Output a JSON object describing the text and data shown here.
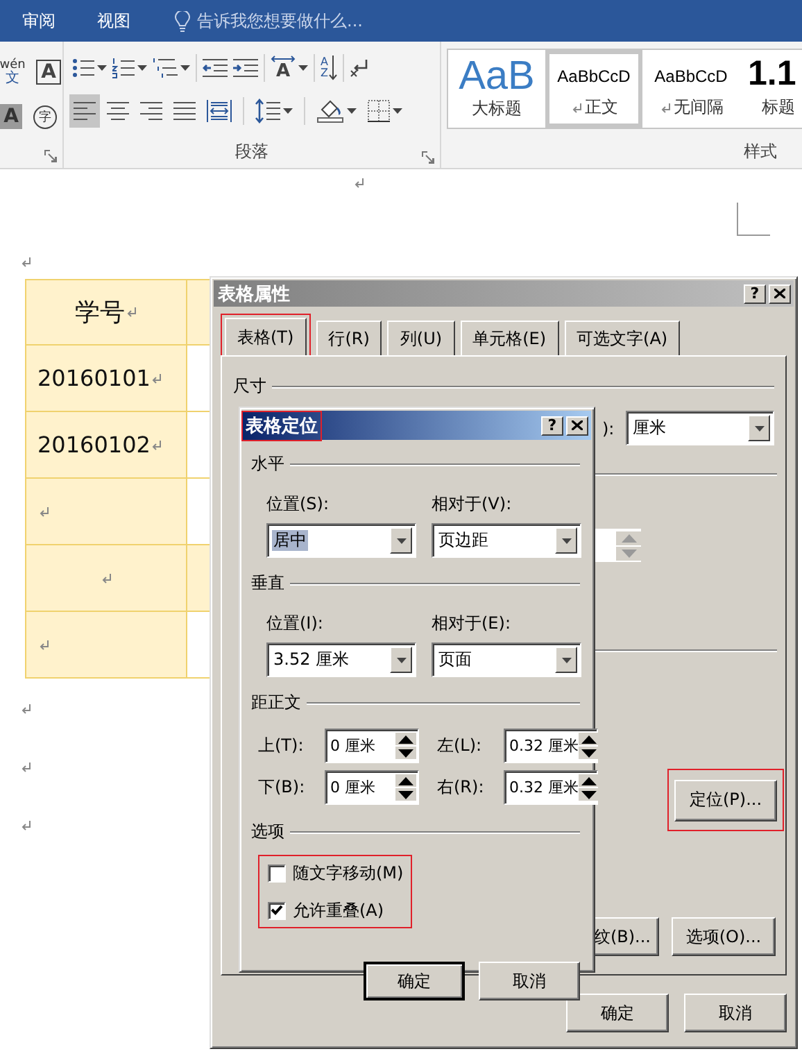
{
  "top_bar": {
    "tabs": [
      {
        "label": "审阅",
        "selected": false
      },
      {
        "label": "视图",
        "selected": false
      }
    ],
    "search": {
      "placeholder": "告诉我您想要做什么..."
    }
  },
  "ribbon": {
    "font_tools": [
      {
        "kind": "phonetic",
        "glyph": "wén",
        "sub": "文"
      },
      {
        "kind": "boxed",
        "glyph": "A"
      },
      {
        "kind": "shaded",
        "glyph": "A"
      },
      {
        "kind": "circled",
        "glyph": "字"
      }
    ],
    "paragraph": {
      "label": "段落",
      "rows": [
        [
          {
            "kind": "bullets",
            "dropdown": true,
            "selected": false
          },
          {
            "kind": "numbering",
            "dropdown": true,
            "selected": false
          },
          {
            "kind": "multilevel",
            "dropdown": true,
            "selected": false
          },
          {
            "kind": "outdent",
            "dropdown": false,
            "selected": false
          },
          {
            "kind": "indent",
            "dropdown": false,
            "selected": false
          },
          {
            "kind": "asian-layout",
            "glyph": "A",
            "dropdown": true,
            "selected": false
          },
          {
            "kind": "sort",
            "glyph": "A",
            "glyph2": "Z",
            "dropdown": false,
            "selected": false
          },
          {
            "kind": "marks",
            "dropdown": false,
            "selected": false
          }
        ],
        [
          {
            "kind": "align-left",
            "dropdown": false,
            "selected": true
          },
          {
            "kind": "align-center",
            "dropdown": false,
            "selected": false
          },
          {
            "kind": "align-right",
            "dropdown": false,
            "selected": false
          },
          {
            "kind": "justify",
            "dropdown": false,
            "selected": false
          },
          {
            "kind": "distribute",
            "dropdown": false,
            "selected": false
          },
          {
            "kind": "line-spacing",
            "dropdown": true,
            "selected": false
          },
          {
            "kind": "shading",
            "dropdown": true,
            "selected": false
          },
          {
            "kind": "borders",
            "dropdown": true,
            "selected": false
          }
        ]
      ]
    },
    "styles": {
      "label": "样式",
      "items": [
        {
          "kind": "title",
          "preview": "AaB",
          "name": "大标题",
          "para_mark": false,
          "selected": false
        },
        {
          "kind": "normal",
          "preview": "AaBbCcD",
          "name": "正文",
          "para_mark": true,
          "selected": true
        },
        {
          "kind": "normal",
          "preview": "AaBbCcD",
          "name": "无间隔",
          "para_mark": true,
          "selected": false
        },
        {
          "kind": "heading",
          "preview": "1.1",
          "name": "标题",
          "para_mark": false,
          "selected": false
        }
      ]
    }
  },
  "document": {
    "table": {
      "rows": [
        {
          "kind": "header",
          "text": "学号",
          "centered": true,
          "column_2_shaded": true
        },
        {
          "kind": "data",
          "text": "20160101",
          "centered": false,
          "column_2_shaded": false
        },
        {
          "kind": "data",
          "text": "20160102",
          "centered": false,
          "column_2_shaded": false
        },
        {
          "kind": "data",
          "centered": false,
          "column_2_shaded": false
        },
        {
          "kind": "data",
          "centered": true,
          "column_2_shaded": true
        },
        {
          "kind": "data",
          "centered": false,
          "column_2_shaded": false
        }
      ]
    }
  },
  "table_properties": {
    "title": "表格属性",
    "help": "?",
    "tabs": [
      {
        "label": "表格(T)",
        "selected": true,
        "highlighted": true
      },
      {
        "label": "行(R)",
        "selected": false,
        "highlighted": false
      },
      {
        "label": "列(U)",
        "selected": false,
        "highlighted": false
      },
      {
        "label": "单元格(E)",
        "selected": false,
        "highlighted": false
      },
      {
        "label": "可选文字(A)",
        "selected": false,
        "highlighted": false
      }
    ],
    "size_group": "尺寸",
    "unit_label": "):",
    "unit_value": "厘米",
    "panel_buttons": [
      {
        "label": "定位(P)...",
        "highlighted": true
      },
      {
        "label": "纹(B)...",
        "highlighted": false
      },
      {
        "label": "选项(O)...",
        "highlighted": false
      }
    ],
    "buttons": [
      {
        "label": "确定"
      },
      {
        "label": "取消"
      }
    ]
  },
  "table_positioning": {
    "title": "表格定位",
    "title_highlighted": true,
    "help": "?",
    "horizontal": {
      "label": "水平",
      "position_label": "位置(S):",
      "position": "居中",
      "position_selected": true,
      "relative_label": "相对于(V):",
      "relative": "页边距"
    },
    "vertical": {
      "label": "垂直",
      "position_label": "位置(I):",
      "position": "3.52 厘米",
      "position_selected": false,
      "relative_label": "相对于(E):",
      "relative": "页面"
    },
    "distance": {
      "label": "距正文",
      "fields": [
        {
          "label": "上(T):",
          "value": "0 厘米"
        },
        {
          "label": "左(L):",
          "value": "0.32 厘米"
        },
        {
          "label": "下(B):",
          "value": "0 厘米"
        },
        {
          "label": "右(R):",
          "value": "0.32 厘米"
        }
      ]
    },
    "options": {
      "label": "选项",
      "highlighted": true,
      "items": [
        {
          "label": "随文字移动(M)",
          "checked": false
        },
        {
          "label": "允许重叠(A)",
          "checked": true
        }
      ]
    },
    "buttons": [
      {
        "label": "确定",
        "default": true
      },
      {
        "label": "取消",
        "default": false
      }
    ]
  }
}
